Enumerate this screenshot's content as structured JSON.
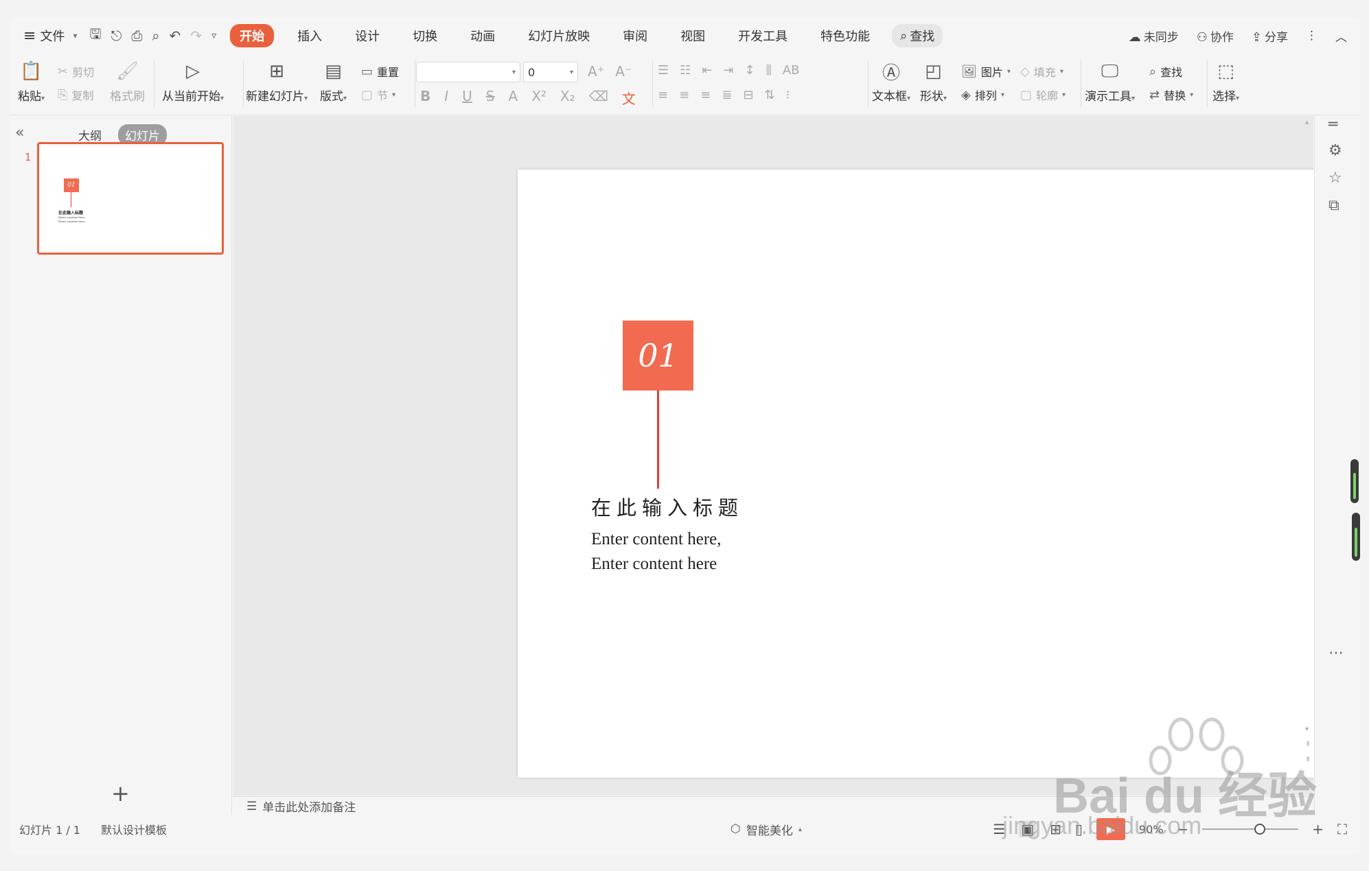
{
  "menubar": {
    "file": "文件",
    "tabs": [
      {
        "label": "开始",
        "active": true
      },
      {
        "label": "插入"
      },
      {
        "label": "设计"
      },
      {
        "label": "切换"
      },
      {
        "label": "动画"
      },
      {
        "label": "幻灯片放映"
      },
      {
        "label": "审阅"
      },
      {
        "label": "视图"
      },
      {
        "label": "开发工具"
      },
      {
        "label": "特色功能"
      }
    ],
    "search": "查找",
    "right": {
      "sync": "未同步",
      "collab": "协作",
      "share": "分享"
    }
  },
  "ribbon": {
    "paste": "粘贴",
    "cut": "剪切",
    "copy": "复制",
    "format_painter": "格式刷",
    "from_current": "从当前开始",
    "new_slide": "新建幻灯片",
    "layout": "版式",
    "reset": "重置",
    "section": "节",
    "font_size": "0",
    "text_box": "文本框",
    "shape": "形状",
    "picture": "图片",
    "fill": "填充",
    "arrange": "排列",
    "outline": "轮廓",
    "presentation_tools": "演示工具",
    "find": "查找",
    "replace": "替换",
    "select": "选择"
  },
  "left_panel": {
    "tabs": [
      {
        "label": "大纲"
      },
      {
        "label": "幻灯片",
        "active": true
      }
    ],
    "slide_number": "1"
  },
  "slide": {
    "number_box": "01",
    "title": "在此输入标题",
    "body_line1": "Enter content here,",
    "body_line2": "Enter content here",
    "accent_color": "#f26b50",
    "line_color": "#e53935"
  },
  "thumbnail": {
    "number_box": "01",
    "title": "在此输入标题",
    "body_line1": "Enter content here,",
    "body_line2": "Enter content here"
  },
  "notes": {
    "placeholder": "单击此处添加备注"
  },
  "statusbar": {
    "slide_info": "幻灯片 1 / 1",
    "template": "默认设计模板",
    "beautify": "智能美化",
    "zoom": "90%"
  },
  "watermark": {
    "brand": "Bai du 经验",
    "url": "jingyan.baidu.com"
  },
  "colors": {
    "accent": "#e8603c",
    "background": "#f5f5f5"
  }
}
